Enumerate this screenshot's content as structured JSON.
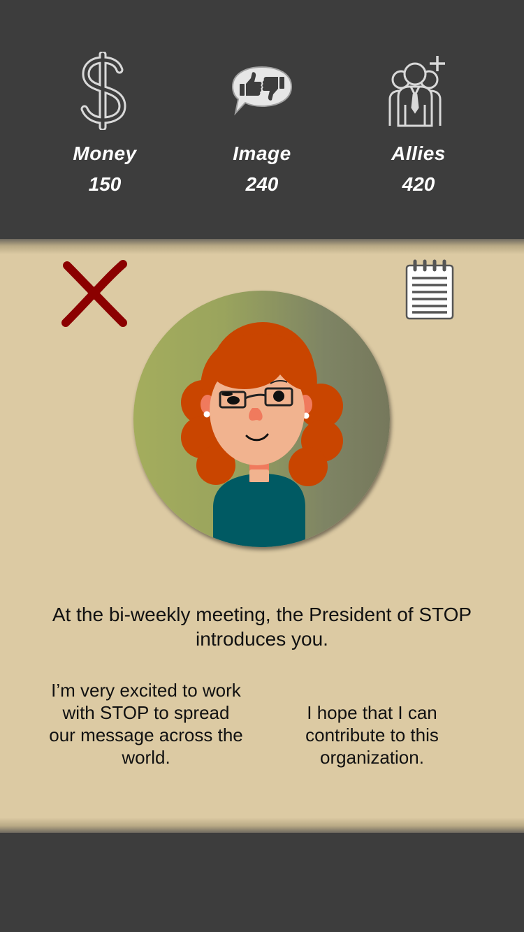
{
  "stats": {
    "money": {
      "label": "Money",
      "value": "150",
      "icon": "dollar-icon"
    },
    "image": {
      "label": "Image",
      "value": "240",
      "icon": "thumbs-up-down-icon"
    },
    "allies": {
      "label": "Allies",
      "value": "420",
      "icon": "add-allies-icon"
    }
  },
  "card": {
    "close_icon": "close-x-icon",
    "notes_icon": "notepad-icon",
    "portrait": "president-avatar",
    "narration": "At the bi-weekly meeting, the President of STOP introduces you.",
    "choices": [
      {
        "text": "I’m very excited to work with STOP to spread our message across the world."
      },
      {
        "text": "I hope that I can contribute to this organization."
      }
    ]
  },
  "colors": {
    "background": "#3d3d3d",
    "card": "#dccaa3",
    "close_x": "#8b0000",
    "hair": "#c94500",
    "shirt": "#005a63"
  }
}
